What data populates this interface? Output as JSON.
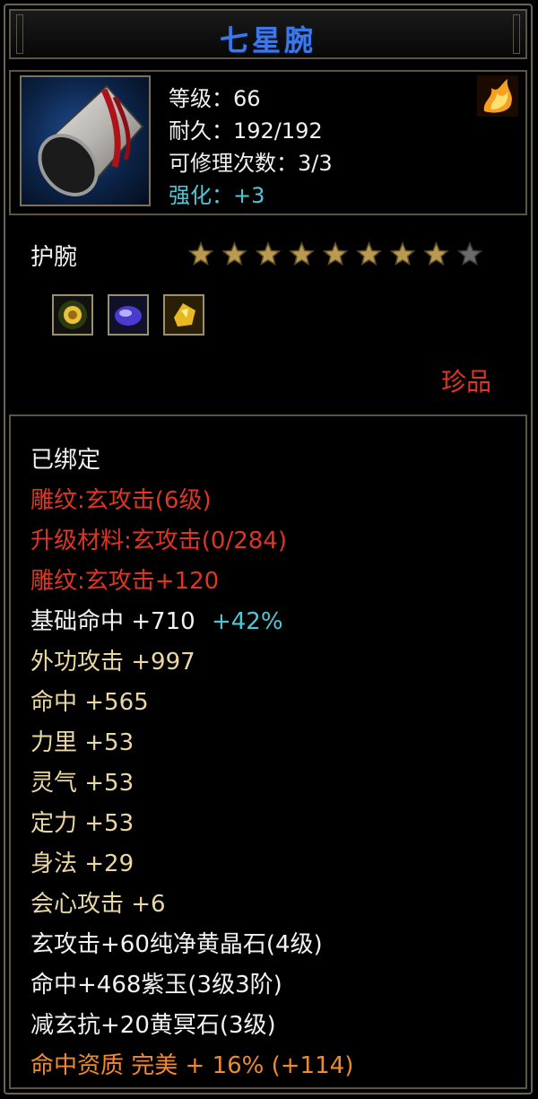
{
  "item": {
    "name": "七星腕",
    "level": "等级：66",
    "durability": "耐久：192/192",
    "repairs": "可修理次数：3/3",
    "enhance": "强化：+3",
    "subtype": "护腕",
    "stars_total": 9,
    "stars_lit": 8,
    "quality": "珍品"
  },
  "gems": [
    "gold-gem-icon",
    "purple-gem-icon",
    "yellow-gem-icon"
  ],
  "attributes": {
    "bound": "已绑定",
    "engrave1": "雕纹:玄攻击(6级)",
    "upgrade": "升级材料:玄攻击(0/284)",
    "engrave2": "雕纹:玄攻击+120",
    "hit_base": "基础命中 +710",
    "hit_base_pct": "+42%",
    "ext_attack": "外功攻击 +997",
    "hit": "命中 +565",
    "strength": "力里 +53",
    "spirit": "灵气 +53",
    "focus": "定力 +53",
    "agility": "身法 +29",
    "crit": "会心攻击 +6",
    "socket1": "玄攻击+60纯净黄晶石(4级)",
    "socket2": "命中+468紫玉(3级3阶)",
    "socket3": "减玄抗+20黄冥石(3级)",
    "aptitude": "命中资质 完美 + 16% (+114)"
  },
  "colors": {
    "title": "#3c78e8",
    "red": "#e03424",
    "beige": "#ead7a5",
    "orange": "#f08a2c",
    "cyan": "#4ec8d8",
    "border": "#5b5447"
  }
}
